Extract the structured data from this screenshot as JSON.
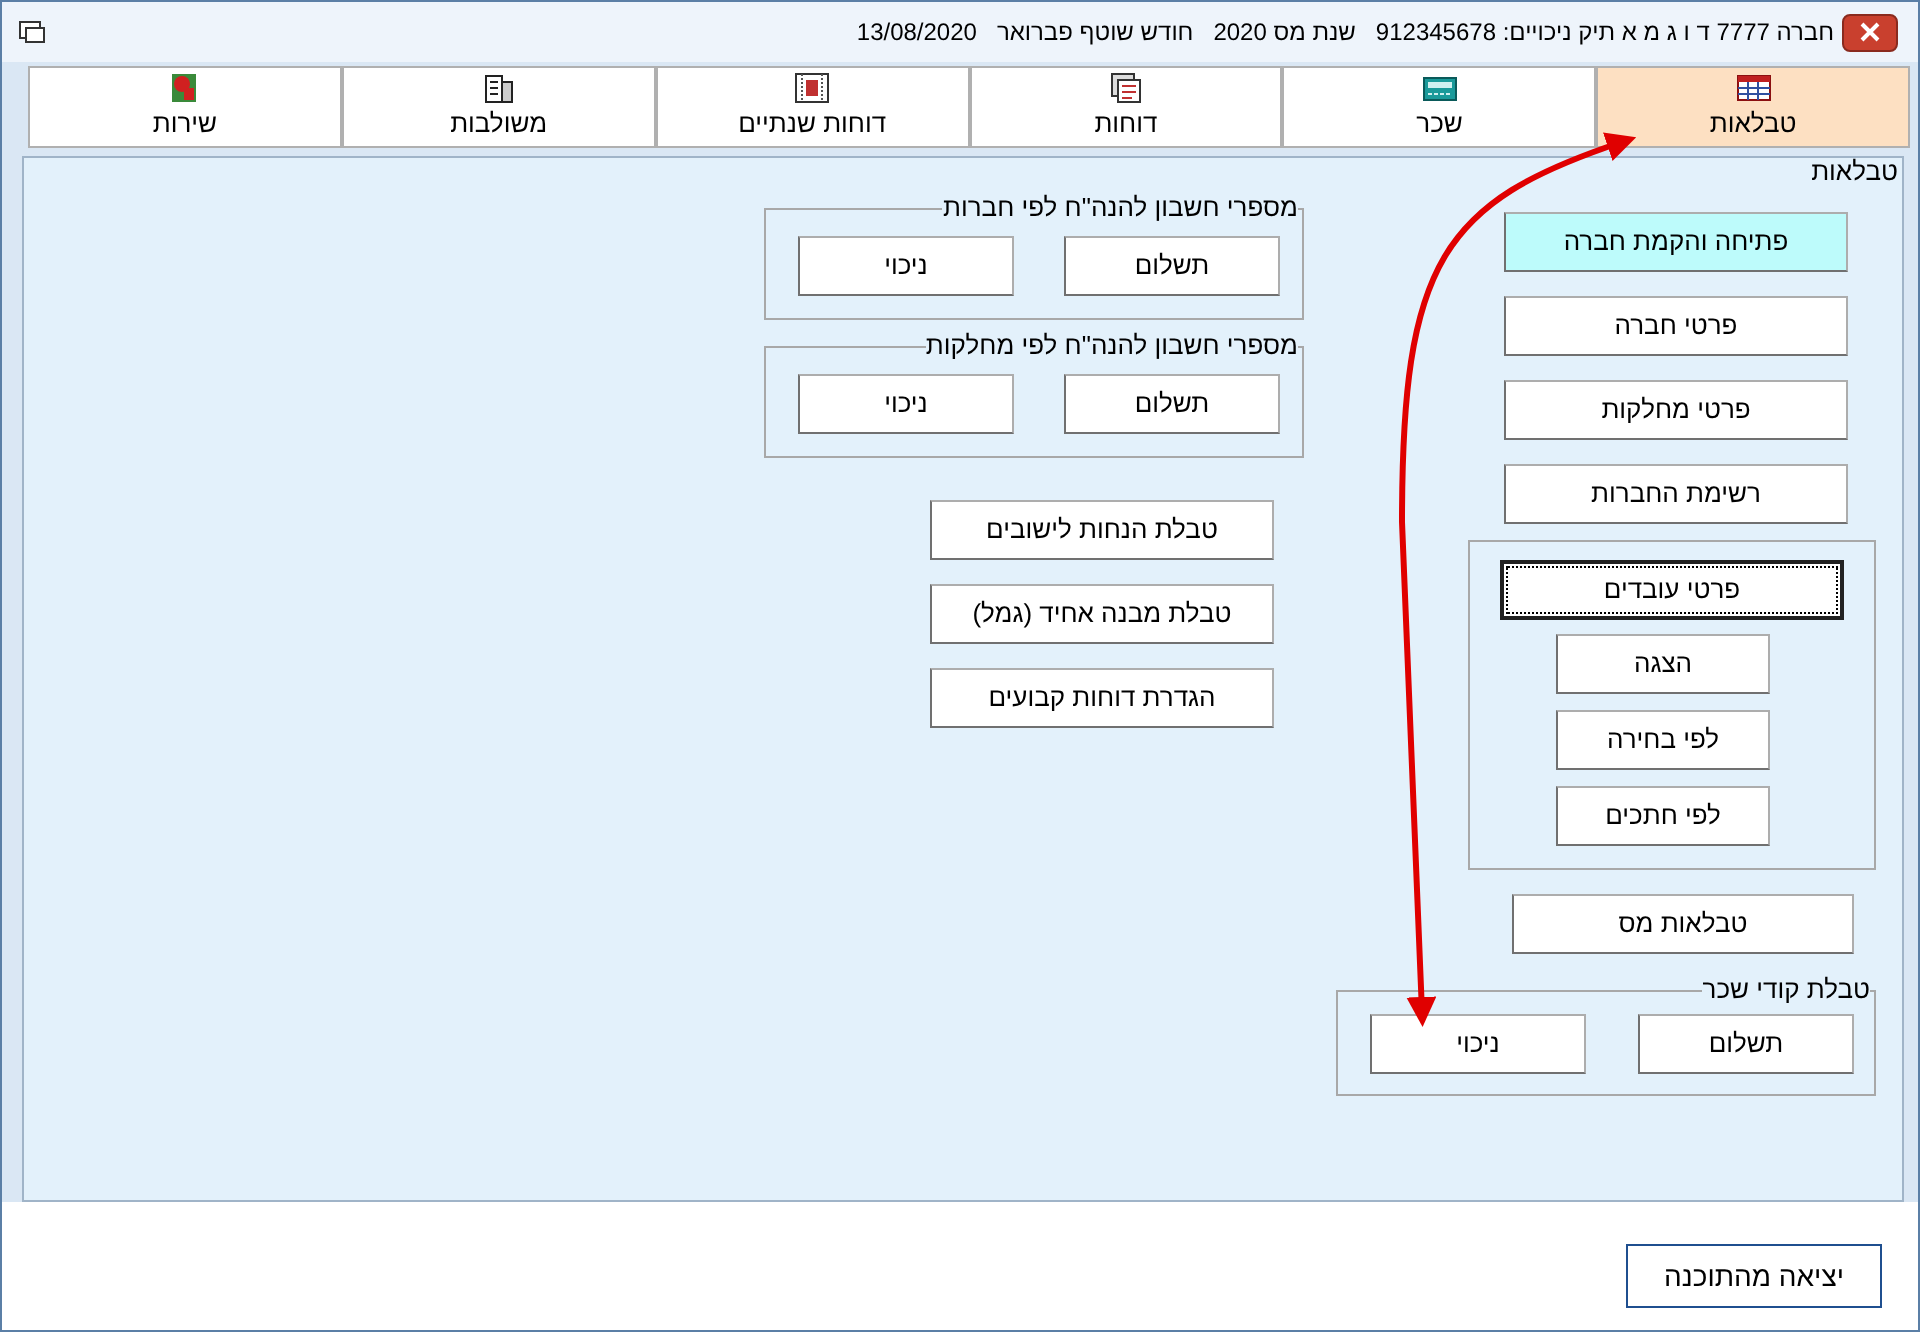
{
  "window": {
    "title_parts": [
      "חברה 7777 ד ו ג מ א תיק ניכויים: 912345678",
      "שנת מס 2020",
      "חודש שוטף פברואר",
      "13/08/2020"
    ]
  },
  "tabs": [
    {
      "label": "טבלאות",
      "selected": true
    },
    {
      "label": "שכר",
      "selected": false
    },
    {
      "label": "דוחות",
      "selected": false
    },
    {
      "label": "דוחות שנתיים",
      "selected": false
    },
    {
      "label": "משולבות",
      "selected": false
    },
    {
      "label": "שירות",
      "selected": false
    }
  ],
  "panel": {
    "title": "טבלאות",
    "company_buttons": [
      {
        "label": "פתיחה והקמת חברה",
        "kind": "highlighted"
      },
      {
        "label": "פרטי חברה",
        "kind": "normal"
      },
      {
        "label": "פרטי מחלקות",
        "kind": "normal"
      },
      {
        "label": "רשימת החברות",
        "kind": "normal"
      }
    ],
    "employees_group": {
      "main_button": {
        "label": "פרטי עובדים",
        "focused": true
      },
      "buttons": [
        "הצגה",
        "לפי בחירה",
        "לפי חתכים"
      ]
    },
    "tax_button": "טבלאות מס",
    "pay_codes_group": {
      "title": "טבלת קודי שכר",
      "buttons": [
        "תשלום",
        "ניכוי"
      ]
    },
    "account_groups": [
      {
        "title": "מספרי חשבון להנה\"ח לפי חברות",
        "buttons": [
          "תשלום",
          "ניכוי"
        ]
      },
      {
        "title": "מספרי חשבון להנה\"ח לפי מחלקות",
        "buttons": [
          "תשלום",
          "ניכוי"
        ]
      }
    ],
    "table_buttons": [
      "טבלת הנחות לישובים",
      "טבלת מבנה אחיד (גמל)",
      "הגדרת דוחות קבועים"
    ]
  },
  "exit_button": "יציאה מהתוכנה"
}
